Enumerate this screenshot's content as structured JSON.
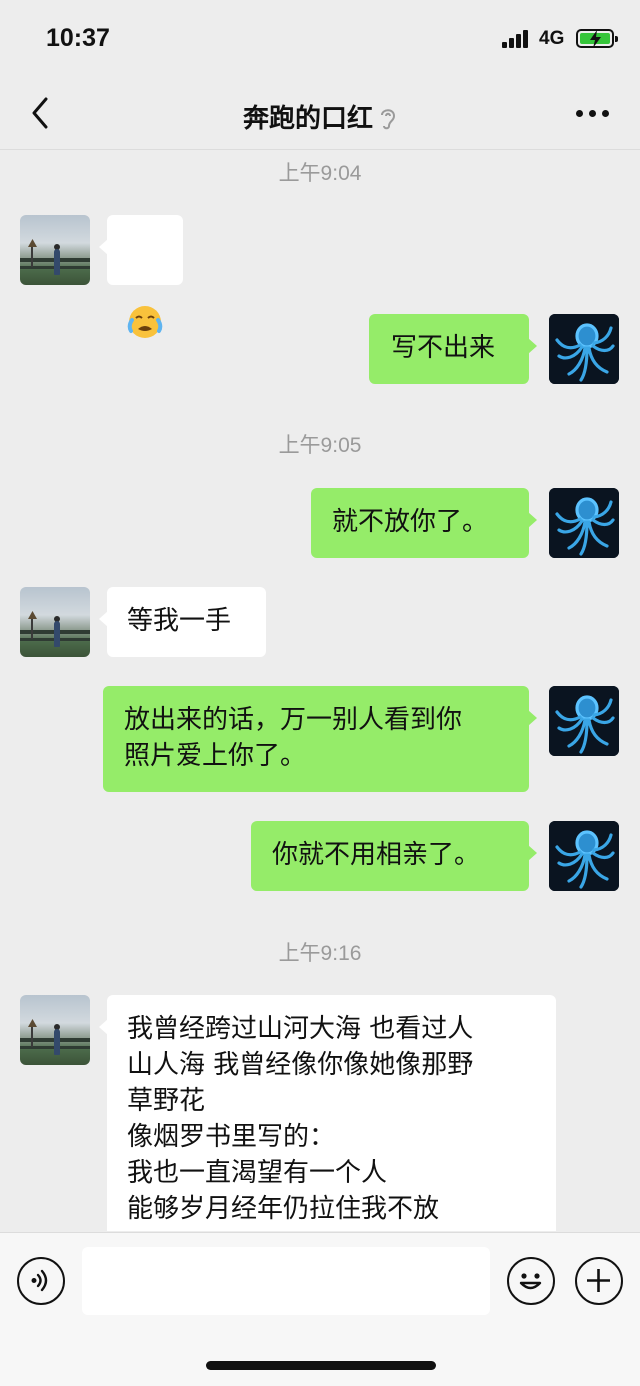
{
  "status_bar": {
    "time": "10:37",
    "network": "4G",
    "battery_color": "#35c53a"
  },
  "header": {
    "title": "奔跑的口红",
    "back_icon": "chevron-left-icon",
    "mute_icon": "ear-icon",
    "more_icon": "more-icon"
  },
  "colors": {
    "incoming_bubble": "#ffffff",
    "outgoing_bubble": "#95ec69",
    "background": "#ededed",
    "timestamp": "#9a9a9a"
  },
  "messages": [
    {
      "type": "timestamp",
      "text": "上午9:04"
    },
    {
      "type": "incoming",
      "content": "emoji",
      "emoji": "crying-face-icon"
    },
    {
      "type": "outgoing",
      "text": "写不出来"
    },
    {
      "type": "timestamp",
      "text": "上午9:05"
    },
    {
      "type": "outgoing",
      "text": "就不放你了。"
    },
    {
      "type": "incoming",
      "text": "等我一手"
    },
    {
      "type": "outgoing",
      "text": "放出来的话，万一别人看到你\n照片爱上你了。"
    },
    {
      "type": "outgoing",
      "text": "你就不用相亲了。"
    },
    {
      "type": "timestamp",
      "text": "上午9:16"
    },
    {
      "type": "incoming",
      "text": "我曾经跨过山河大海 也看过人\n山人海 我曾经像你像她像那野\n草野花\n像烟罗书里写的：\n我也一直渴望有一个人\n能够岁月经年仍拉住我不放"
    }
  ],
  "input_bar": {
    "voice_icon": "voice-icon",
    "emoji_icon": "emoji-icon",
    "plus_icon": "plus-icon",
    "input_value": ""
  }
}
